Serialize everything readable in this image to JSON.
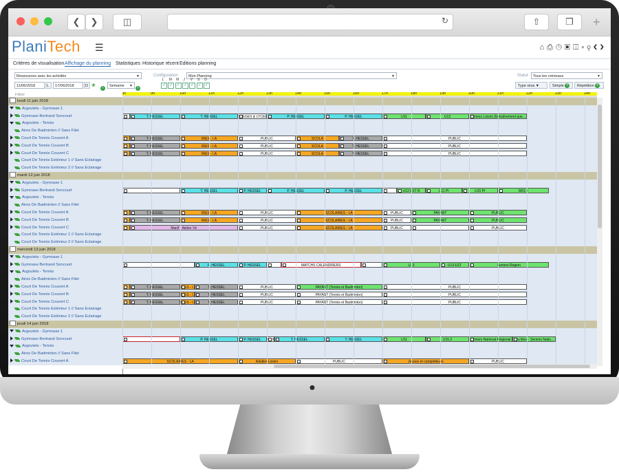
{
  "app": {
    "logo_plani": "Plani",
    "logo_tech": "Tech"
  },
  "menu": [
    "Critères de visualisation",
    "Affichage du planning",
    "Statistiques",
    "Historique récent",
    "Editions planning"
  ],
  "filters": {
    "ressources": "Ressources avec les activités",
    "configuration_label": "Configuration",
    "configuration_value": "Mon Planning",
    "statut_label": "Statut",
    "statut_value": "Tous les créneaux",
    "date_from": "11/06/2018",
    "date_from_btn": "L",
    "date_to": "17/06/2018",
    "date_to_btn": "D",
    "period": "Semaine",
    "days": [
      "L",
      "M",
      "M",
      "J",
      "V",
      "S",
      "D"
    ],
    "type_resa": "Type résa",
    "simple": "Simple",
    "repetition": "Répétition",
    "filter_placeholder": "Filtrer"
  },
  "hours": [
    "8h",
    "9h",
    "10h",
    "11h",
    "12h",
    "13h",
    "14h",
    "15h",
    "16h",
    "17h",
    "18h",
    "19h",
    "20h",
    "21h",
    "22h",
    "23h",
    "24h"
  ],
  "rows": [
    {
      "t": "day",
      "label": "lundi 11 juin 2018"
    },
    {
      "t": "grp",
      "label": "Argoulets - Gymnase 1"
    },
    {
      "t": "res",
      "label": "Gymnase Bertrand Soncourt",
      "exp": true
    },
    {
      "t": "grp",
      "label": "Argoulets - Tennis"
    },
    {
      "t": "res",
      "label": "Aires De Badminton // Sans Filet"
    },
    {
      "t": "res",
      "label": "Court De Tennis Couvert A",
      "exp": true
    },
    {
      "t": "res",
      "label": "Court De Tennis Couvert B",
      "exp": true
    },
    {
      "t": "res",
      "label": "Court De Tennis Couvert C",
      "exp": true
    },
    {
      "t": "res",
      "label": "Court De Tennis Extérieur 1 // Sans Eclairage"
    },
    {
      "t": "res",
      "label": "Court De Tennis Extérieur 2 // Sans Eclairage"
    },
    {
      "t": "day",
      "label": "mardi 12 juin 2018"
    },
    {
      "t": "grp",
      "label": "Argoulets - Gymnase 1"
    },
    {
      "t": "res",
      "label": "Gymnase Bertrand Soncourt",
      "exp": true
    },
    {
      "t": "grp",
      "label": "Argoulets - Tennis"
    },
    {
      "t": "res",
      "label": "Aires De Badminton // Sans Filet"
    },
    {
      "t": "res",
      "label": "Court De Tennis Couvert A",
      "exp": true
    },
    {
      "t": "res",
      "label": "Court De Tennis Couvert B",
      "exp": true
    },
    {
      "t": "res",
      "label": "Court De Tennis Couvert C",
      "exp": true
    },
    {
      "t": "res",
      "label": "Court De Tennis Extérieur 1 // Sans Eclairage"
    },
    {
      "t": "res",
      "label": "Court De Tennis Extérieur 2 // Sans Eclairage"
    },
    {
      "t": "day",
      "label": "mercredi 13 juin 2018"
    },
    {
      "t": "grp",
      "label": "Argoulets - Gymnase 1"
    },
    {
      "t": "res",
      "label": "Gymnase Bertrand Soncourt",
      "exp": true
    },
    {
      "t": "grp",
      "label": "Argoulets - Tennis"
    },
    {
      "t": "res",
      "label": "Aires De Badminton // Sans Filet"
    },
    {
      "t": "res",
      "label": "Court De Tennis Couvert A",
      "exp": true
    },
    {
      "t": "res",
      "label": "Court De Tennis Couvert B",
      "exp": true
    },
    {
      "t": "res",
      "label": "Court De Tennis Couvert C",
      "exp": true
    },
    {
      "t": "res",
      "label": "Court De Tennis Extérieur 1 // Sans Eclairage"
    },
    {
      "t": "res",
      "label": "Court De Tennis Extérieur 2 // Sans Eclairage"
    },
    {
      "t": "day",
      "label": "jeudi 14 juin 2018"
    },
    {
      "t": "grp",
      "label": "Argoulets - Gymnase 1"
    },
    {
      "t": "res",
      "label": "Gymnase Bertrand Soncourt",
      "exp": true
    },
    {
      "t": "grp",
      "label": "Argoulets - Tennis"
    },
    {
      "t": "res",
      "label": "Aires De Badminton // Sans Filet"
    },
    {
      "t": "res",
      "label": "Court De Tennis Couvert A",
      "exp": true
    }
  ],
  "events": [
    {
      "r": 2,
      "s": 8.0,
      "e": 8.25,
      "c": "white",
      "l": ""
    },
    {
      "r": 2,
      "s": 8.25,
      "e": 10.0,
      "c": "cyan",
      "l": "T. HESSEL"
    },
    {
      "r": 2,
      "s": 10.0,
      "e": 12.0,
      "c": "cyan",
      "l": "T. HESSEL"
    },
    {
      "r": 2,
      "s": 12.0,
      "e": 13.0,
      "c": "white",
      "l": "LLEGES & LYCEES A"
    },
    {
      "r": 2,
      "s": 13.0,
      "e": 15.0,
      "c": "cyan",
      "l": "P. HESSEL"
    },
    {
      "r": 2,
      "s": 15.0,
      "e": 17.0,
      "c": "cyan",
      "l": "P. HESSEL"
    },
    {
      "r": 2,
      "s": 17.0,
      "e": 18.5,
      "c": "green",
      "l": "U11"
    },
    {
      "r": 2,
      "s": 18.5,
      "e": 20.0,
      "c": "green",
      "l": "U13"
    },
    {
      "r": 2,
      "s": 20.0,
      "e": 22.0,
      "c": "green",
      "l": "Seniors Loisirs (Entraînement que..."
    },
    {
      "r": 5,
      "s": 8.0,
      "e": 8.25,
      "c": "orange",
      "l": ""
    },
    {
      "r": 5,
      "s": 8.25,
      "e": 10.0,
      "c": "gray",
      "l": "T. HESSEL"
    },
    {
      "r": 5,
      "s": 10.0,
      "e": 12.0,
      "c": "orange",
      "l": "IRES - I.A"
    },
    {
      "r": 5,
      "s": 12.0,
      "e": 14.0,
      "c": "white",
      "l": "PUBLIC"
    },
    {
      "r": 5,
      "s": 14.0,
      "e": 15.5,
      "c": "orange",
      "l": "SCOLA"
    },
    {
      "r": 5,
      "s": 15.5,
      "e": 17.0,
      "c": "gray",
      "l": "T. HESSEL"
    },
    {
      "r": 5,
      "s": 17.0,
      "e": 22.0,
      "c": "white",
      "l": "PUBLIC"
    },
    {
      "r": 6,
      "s": 8.0,
      "e": 8.25,
      "c": "orange",
      "l": ""
    },
    {
      "r": 6,
      "s": 8.25,
      "e": 10.0,
      "c": "gray",
      "l": "T. HESSEL"
    },
    {
      "r": 6,
      "s": 10.0,
      "e": 12.0,
      "c": "orange",
      "l": "IRES - I.A"
    },
    {
      "r": 6,
      "s": 12.0,
      "e": 14.0,
      "c": "white",
      "l": "PUBLIC"
    },
    {
      "r": 6,
      "s": 14.0,
      "e": 15.5,
      "c": "orange",
      "l": "SCOLA"
    },
    {
      "r": 6,
      "s": 15.5,
      "e": 17.0,
      "c": "gray",
      "l": "T. HESSEL"
    },
    {
      "r": 6,
      "s": 17.0,
      "e": 22.0,
      "c": "white",
      "l": "PUBLIC"
    },
    {
      "r": 7,
      "s": 8.0,
      "e": 8.25,
      "c": "orange",
      "l": ""
    },
    {
      "r": 7,
      "s": 8.25,
      "e": 10.0,
      "c": "gray",
      "l": "T. HESSEL"
    },
    {
      "r": 7,
      "s": 10.0,
      "e": 12.0,
      "c": "orange",
      "l": "IRES - I.A"
    },
    {
      "r": 7,
      "s": 12.0,
      "e": 14.0,
      "c": "white",
      "l": "PUBLIC"
    },
    {
      "r": 7,
      "s": 14.0,
      "e": 15.5,
      "c": "orange",
      "l": "SCOLA"
    },
    {
      "r": 7,
      "s": 15.5,
      "e": 17.0,
      "c": "gray",
      "l": "T. HESSEL"
    },
    {
      "r": 7,
      "s": 17.0,
      "e": 22.0,
      "c": "white",
      "l": "PUBLIC"
    },
    {
      "r": 12,
      "s": 8.0,
      "e": 10.0,
      "c": "white",
      "l": ""
    },
    {
      "r": 12,
      "s": 10.0,
      "e": 12.0,
      "c": "cyan",
      "l": "T. HESSEL"
    },
    {
      "r": 12,
      "s": 12.0,
      "e": 13.0,
      "c": "cyan",
      "l": "P. HESSEL"
    },
    {
      "r": 12,
      "s": 13.0,
      "e": 15.0,
      "c": "cyan",
      "l": "P. HESSEL"
    },
    {
      "r": 12,
      "s": 15.0,
      "e": 17.0,
      "c": "cyan",
      "l": "P. HESSEL"
    },
    {
      "r": 12,
      "s": 17.0,
      "e": 17.5,
      "c": "white",
      "l": ""
    },
    {
      "r": 12,
      "s": 17.5,
      "e": 18.5,
      "c": "green",
      "l": "U13 EST B"
    },
    {
      "r": 12,
      "s": 18.5,
      "e": 19.75,
      "c": "green",
      "l": "U11 PI"
    },
    {
      "r": 12,
      "s": 19.75,
      "e": 21.0,
      "c": "green",
      "l": "U15 PI"
    },
    {
      "r": 12,
      "s": 21.0,
      "e": 22.75,
      "c": "green",
      "l": "SRS 4"
    },
    {
      "r": 15,
      "s": 8.0,
      "e": 8.25,
      "c": "orange",
      "l": ""
    },
    {
      "r": 15,
      "s": 8.25,
      "e": 10.0,
      "c": "gray",
      "l": "T. HESSEL"
    },
    {
      "r": 15,
      "s": 10.0,
      "e": 12.0,
      "c": "orange",
      "l": "IRES - I.A"
    },
    {
      "r": 15,
      "s": 12.0,
      "e": 14.0,
      "c": "white",
      "l": "PUBLIC"
    },
    {
      "r": 15,
      "s": 14.0,
      "e": 17.0,
      "c": "orange",
      "l": "SCOLAIRES - I.A"
    },
    {
      "r": 15,
      "s": 17.0,
      "e": 18.0,
      "c": "white",
      "l": "PUBLIC"
    },
    {
      "r": 15,
      "s": 18.0,
      "e": 20.0,
      "c": "green",
      "l": "PAYANT"
    },
    {
      "r": 15,
      "s": 20.0,
      "e": 22.0,
      "c": "green",
      "l": "PUBLIC"
    },
    {
      "r": 16,
      "s": 8.0,
      "e": 8.25,
      "c": "orange",
      "l": ""
    },
    {
      "r": 16,
      "s": 8.25,
      "e": 10.0,
      "c": "gray",
      "l": "T. HESSEL"
    },
    {
      "r": 16,
      "s": 10.0,
      "e": 12.0,
      "c": "orange",
      "l": "IRES - I.A"
    },
    {
      "r": 16,
      "s": 12.0,
      "e": 14.0,
      "c": "white",
      "l": "PUBLIC"
    },
    {
      "r": 16,
      "s": 14.0,
      "e": 17.0,
      "c": "orange",
      "l": "SCOLAIRES - I.A"
    },
    {
      "r": 16,
      "s": 17.0,
      "e": 18.0,
      "c": "white",
      "l": "PUBLIC"
    },
    {
      "r": 16,
      "s": 18.0,
      "e": 20.0,
      "c": "green",
      "l": "PAYANT"
    },
    {
      "r": 16,
      "s": 20.0,
      "e": 22.0,
      "c": "green",
      "l": "PUBLIC"
    },
    {
      "r": 17,
      "s": 8.0,
      "e": 8.25,
      "c": "orange",
      "l": ""
    },
    {
      "r": 17,
      "s": 8.25,
      "e": 12.0,
      "c": "pink",
      "l": "Manif : Atelier Vé"
    },
    {
      "r": 17,
      "s": 12.0,
      "e": 14.0,
      "c": "white",
      "l": "PUBLIC"
    },
    {
      "r": 17,
      "s": 14.0,
      "e": 17.0,
      "c": "orange",
      "l": "SCOLAIRES - I.A"
    },
    {
      "r": 17,
      "s": 17.0,
      "e": 18.0,
      "c": "white",
      "l": "PUBLIC"
    },
    {
      "r": 17,
      "s": 18.0,
      "e": 20.0,
      "c": "white",
      "l": ""
    },
    {
      "r": 17,
      "s": 20.0,
      "e": 22.0,
      "c": "white",
      "l": "PUBLIC"
    },
    {
      "r": 22,
      "s": 8.0,
      "e": 10.5,
      "c": "white",
      "l": ""
    },
    {
      "r": 22,
      "s": 10.5,
      "e": 12.0,
      "c": "cyan",
      "l": "P. HESSEL"
    },
    {
      "r": 22,
      "s": 12.0,
      "e": 13.0,
      "c": "cyan",
      "l": "P. HESSEL"
    },
    {
      "r": 22,
      "s": 13.0,
      "e": 13.5,
      "c": "white",
      "l": ""
    },
    {
      "r": 22,
      "s": 13.5,
      "e": 16.25,
      "c": "white",
      "l": "MATCHS CALENDRIERS",
      "red": true
    },
    {
      "r": 22,
      "s": 16.25,
      "e": 17.0,
      "c": "white",
      "l": ""
    },
    {
      "r": 22,
      "s": 17.0,
      "e": 19.0,
      "c": "green",
      "l": "U13"
    },
    {
      "r": 22,
      "s": 19.0,
      "e": 20.0,
      "c": "green",
      "l": "U13 EST"
    },
    {
      "r": 22,
      "s": 20.0,
      "e": 22.75,
      "c": "green",
      "l": "Seniors Region"
    },
    {
      "r": 25,
      "s": 8.0,
      "e": 8.25,
      "c": "orange",
      "l": ""
    },
    {
      "r": 25,
      "s": 8.25,
      "e": 10.0,
      "c": "gray",
      "l": "T. HESSEL"
    },
    {
      "r": 25,
      "s": 10.0,
      "e": 10.5,
      "c": "orange",
      "l": "IRES - I.A"
    },
    {
      "r": 25,
      "s": 10.5,
      "e": 12.0,
      "c": "gray",
      "l": "T. HESSEL"
    },
    {
      "r": 25,
      "s": 12.0,
      "e": 14.0,
      "c": "white",
      "l": "PUBLIC"
    },
    {
      "r": 25,
      "s": 14.0,
      "e": 17.0,
      "c": "green",
      "l": "PAYANT (Tennis et Badminton)"
    },
    {
      "r": 25,
      "s": 17.0,
      "e": 22.0,
      "c": "white",
      "l": "PUBLIC"
    },
    {
      "r": 26,
      "s": 8.0,
      "e": 8.25,
      "c": "orange",
      "l": ""
    },
    {
      "r": 26,
      "s": 8.25,
      "e": 10.0,
      "c": "gray",
      "l": "T. HESSEL"
    },
    {
      "r": 26,
      "s": 10.0,
      "e": 10.5,
      "c": "orange",
      "l": "IRES - I.A"
    },
    {
      "r": 26,
      "s": 10.5,
      "e": 12.0,
      "c": "gray",
      "l": "T. HESSEL"
    },
    {
      "r": 26,
      "s": 12.0,
      "e": 14.0,
      "c": "white",
      "l": "PUBLIC"
    },
    {
      "r": 26,
      "s": 14.0,
      "e": 17.0,
      "c": "white",
      "l": "PAYANT (Tennis et Badminton)"
    },
    {
      "r": 26,
      "s": 17.0,
      "e": 22.0,
      "c": "white",
      "l": "PUBLIC"
    },
    {
      "r": 27,
      "s": 8.0,
      "e": 8.25,
      "c": "orange",
      "l": ""
    },
    {
      "r": 27,
      "s": 8.25,
      "e": 10.0,
      "c": "gray",
      "l": "T. HESSEL"
    },
    {
      "r": 27,
      "s": 10.0,
      "e": 10.5,
      "c": "orange",
      "l": "IRES - I.A"
    },
    {
      "r": 27,
      "s": 10.5,
      "e": 12.0,
      "c": "gray",
      "l": "T. HESSEL"
    },
    {
      "r": 27,
      "s": 12.0,
      "e": 14.0,
      "c": "white",
      "l": "PUBLIC"
    },
    {
      "r": 27,
      "s": 14.0,
      "e": 17.0,
      "c": "white",
      "l": "PAYANT (Tennis et Badminton)"
    },
    {
      "r": 27,
      "s": 17.0,
      "e": 22.0,
      "c": "white",
      "l": "PUBLIC"
    },
    {
      "r": 32,
      "s": 8.0,
      "e": 10.0,
      "c": "white",
      "l": "",
      "red": true
    },
    {
      "r": 32,
      "s": 10.0,
      "e": 12.0,
      "c": "cyan",
      "l": "P. HESSEL"
    },
    {
      "r": 32,
      "s": 12.0,
      "e": 13.0,
      "c": "cyan",
      "l": "P. HESSEL"
    },
    {
      "r": 32,
      "s": 13.0,
      "e": 13.25,
      "c": "white",
      "l": "OLII"
    },
    {
      "r": 32,
      "s": 13.25,
      "e": 15.0,
      "c": "cyan",
      "l": "T. HESSEL"
    },
    {
      "r": 32,
      "s": 15.0,
      "e": 17.0,
      "c": "cyan",
      "l": "T. HESSEL"
    },
    {
      "r": 32,
      "s": 17.0,
      "e": 18.5,
      "c": "green",
      "l": "U11"
    },
    {
      "r": 32,
      "s": 18.5,
      "e": 20.0,
      "c": "green",
      "l": "U15.2"
    },
    {
      "r": 32,
      "s": 20.0,
      "e": 21.5,
      "c": "green",
      "l": "Seniors National-Régional"
    },
    {
      "r": 32,
      "s": 21.5,
      "e": 23.0,
      "c": "green",
      "l": "Jeu libre - Seniors Natio..."
    },
    {
      "r": 35,
      "s": 8.0,
      "e": 12.0,
      "c": "orange",
      "l": "SCOLAIRES - I.A"
    },
    {
      "r": 35,
      "s": 12.0,
      "e": 14.0,
      "c": "orange",
      "l": "Adultes Loisirs"
    },
    {
      "r": 35,
      "s": 14.0,
      "e": 17.0,
      "c": "white",
      "l": "PUBLIC"
    },
    {
      "r": 35,
      "s": 17.0,
      "e": 20.0,
      "c": "orange",
      "l": "Jeunes et compétiteurs"
    },
    {
      "r": 35,
      "s": 20.0,
      "e": 22.0,
      "c": "white",
      "l": "PUBLIC"
    }
  ]
}
